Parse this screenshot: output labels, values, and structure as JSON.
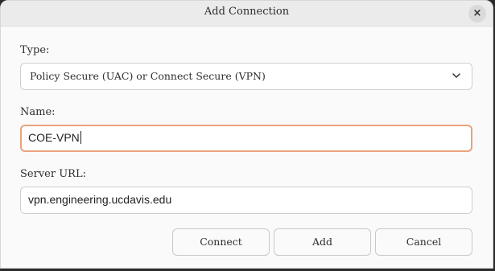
{
  "dialog": {
    "title": "Add Connection",
    "close_icon": "×"
  },
  "type_field": {
    "label": "Type:",
    "selected": "Policy Secure (UAC) or Connect Secure (VPN)"
  },
  "name_field": {
    "label": "Name:",
    "value": "COE-VPN"
  },
  "server_field": {
    "label": "Server URL:",
    "value": "vpn.engineering.ucdavis.edu"
  },
  "buttons": {
    "connect": "Connect",
    "add": "Add",
    "cancel": "Cancel"
  },
  "colors": {
    "focus_border": "#e9a27c",
    "background": "#fafafa"
  },
  "icons": {
    "close": "close-icon",
    "dropdown": "chevron-down-icon"
  }
}
